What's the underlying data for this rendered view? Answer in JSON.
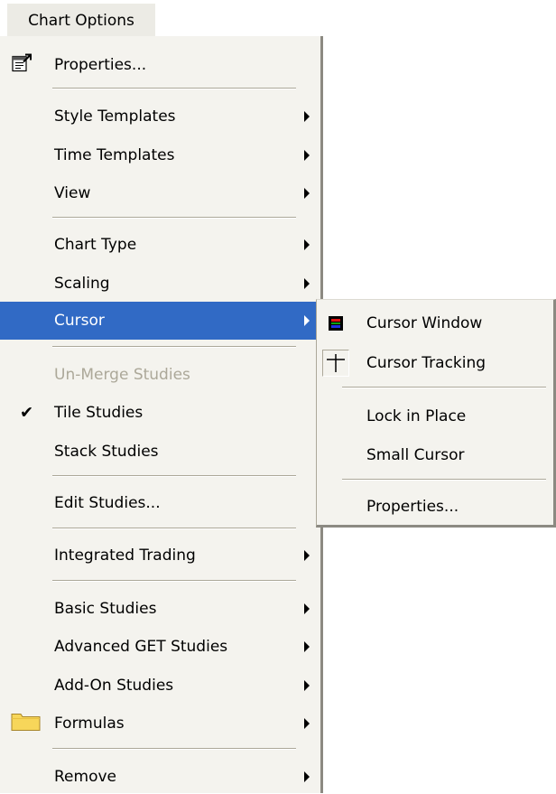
{
  "menubar": {
    "title": "Chart Options"
  },
  "main_menu": {
    "properties": "Properties...",
    "style_templates": "Style Templates",
    "time_templates": "Time Templates",
    "view": "View",
    "chart_type": "Chart Type",
    "scaling": "Scaling",
    "cursor": "Cursor",
    "unmerge_studies": "Un-Merge Studies",
    "tile_studies": "Tile Studies",
    "stack_studies": "Stack Studies",
    "edit_studies": "Edit Studies...",
    "integrated_trading": "Integrated Trading",
    "basic_studies": "Basic Studies",
    "advanced_get_studies": "Advanced GET Studies",
    "addon_studies": "Add-On Studies",
    "formulas": "Formulas",
    "remove": "Remove"
  },
  "cursor_submenu": {
    "cursor_window": "Cursor Window",
    "cursor_tracking": "Cursor Tracking",
    "lock_in_place": "Lock in Place",
    "small_cursor": "Small Cursor",
    "properties": "Properties..."
  },
  "colors": {
    "selection": "#316ac5",
    "menu_bg": "#f4f3ee",
    "disabled_text": "#aca899"
  },
  "icons": {
    "properties": "properties-sheet-icon",
    "formulas": "folder-icon",
    "cursor_window": "cursor-window-icon",
    "cursor_tracking": "crosshair-icon",
    "tile_studies_state": "checkmark-icon"
  }
}
